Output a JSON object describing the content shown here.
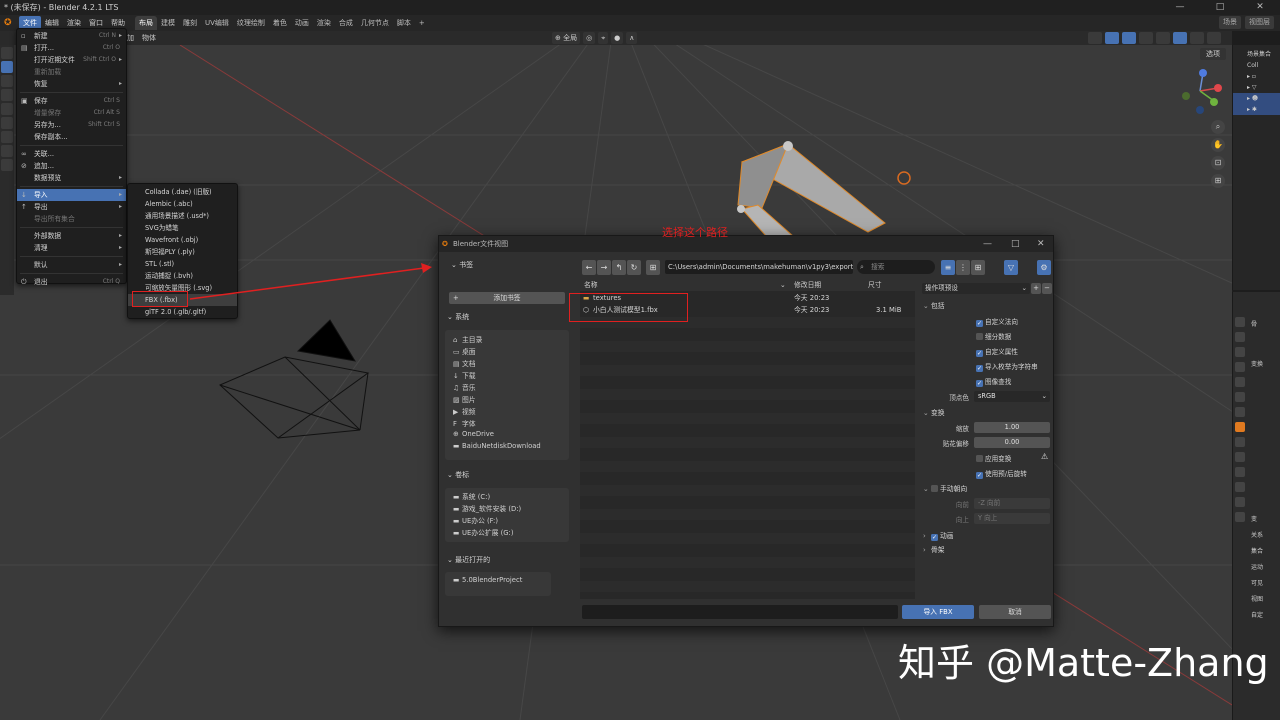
{
  "window": {
    "title": "* (未保存) - Blender 4.2.1 LTS",
    "controls": [
      "—",
      "□",
      "✕"
    ]
  },
  "menubar": {
    "menus": [
      "文件",
      "编辑",
      "渲染",
      "窗口",
      "帮助"
    ],
    "workspaces": [
      "布局",
      "建模",
      "雕刻",
      "UV编辑",
      "纹理绘制",
      "着色",
      "动画",
      "渲染",
      "合成",
      "几何节点",
      "脚本",
      "+"
    ],
    "right_items": [
      "场景",
      "视图层"
    ]
  },
  "viewport_header": {
    "items": [
      "添加",
      "物体"
    ],
    "pivot": "全局",
    "select_label": "选项"
  },
  "file_menu": {
    "items": [
      {
        "label": "新建",
        "shortcut": "Ctrl N",
        "arrow": true,
        "icon": "▫"
      },
      {
        "label": "打开...",
        "shortcut": "Ctrl O",
        "icon": "▤"
      },
      {
        "label": "打开近期文件",
        "shortcut": "Shift Ctrl O",
        "arrow": true
      },
      {
        "label": "重新加载",
        "disabled": true
      },
      {
        "label": "恢复",
        "arrow": true
      },
      {
        "sep": true
      },
      {
        "label": "保存",
        "shortcut": "Ctrl S",
        "icon": "▣"
      },
      {
        "label": "增量保存",
        "shortcut": "Ctrl Alt S",
        "disabled": true
      },
      {
        "label": "另存为...",
        "shortcut": "Shift Ctrl S"
      },
      {
        "label": "保存副本..."
      },
      {
        "sep": true
      },
      {
        "label": "关联...",
        "icon": "∞"
      },
      {
        "label": "追加...",
        "icon": "⊘"
      },
      {
        "label": "数据预览",
        "arrow": true
      },
      {
        "sep": true
      },
      {
        "label": "导入",
        "arrow": true,
        "highlighted": true,
        "icon": "↓"
      },
      {
        "label": "导出",
        "arrow": true,
        "icon": "↑"
      },
      {
        "label": "导出所有集合",
        "disabled": true
      },
      {
        "sep": true
      },
      {
        "label": "外部数据",
        "arrow": true
      },
      {
        "label": "清理",
        "arrow": true
      },
      {
        "sep": true
      },
      {
        "label": "默认",
        "arrow": true
      },
      {
        "sep": true
      },
      {
        "label": "退出",
        "shortcut": "Ctrl Q",
        "icon": "⏻"
      }
    ]
  },
  "import_submenu": {
    "items": [
      "Collada (.dae) (旧版)",
      "Alembic (.abc)",
      "通用场景描述 (.usd*)",
      "SVG为蜡笔",
      "Wavefront (.obj)",
      "斯坦福PLY (.ply)",
      "STL (.stl)",
      "运动捕捉 (.bvh)",
      "可缩放矢量图形 (.svg)",
      "FBX (.fbx)",
      "glTF 2.0 (.glb/.gltf)"
    ],
    "highlighted_index": 9
  },
  "annotation": {
    "callout": "选择这个路径",
    "color": "#e02020"
  },
  "dialog": {
    "title": "Blender文件视图",
    "bookmarks": {
      "header": "书签",
      "add_label": "添加书签"
    },
    "system": {
      "header": "系统",
      "items": [
        {
          "label": "主目录",
          "icon": "⌂"
        },
        {
          "label": "桌面",
          "icon": "▭"
        },
        {
          "label": "文档",
          "icon": "▤"
        },
        {
          "label": "下载",
          "icon": "↓"
        },
        {
          "label": "音乐",
          "icon": "♫"
        },
        {
          "label": "图片",
          "icon": "▨"
        },
        {
          "label": "视频",
          "icon": "▶"
        },
        {
          "label": "字体",
          "icon": "F"
        },
        {
          "label": "OneDrive",
          "icon": "⊕"
        },
        {
          "label": "BaiduNetdiskDownload",
          "icon": "▬"
        }
      ]
    },
    "volumes": {
      "header": "卷标",
      "items": [
        "系统 (C:)",
        "游戏_软件安装 (D:)",
        "UE办公 (F:)",
        "UE办公扩展 (G:)"
      ]
    },
    "recent": {
      "header": "最近打开的",
      "items": [
        "5.0BlenderProject"
      ]
    },
    "path": "C:\\Users\\admin\\Documents\\makehuman\\v1py3\\exports\\",
    "search_placeholder": "搜索",
    "columns": {
      "name": "名称",
      "date": "修改日期",
      "size": "尺寸"
    },
    "files": [
      {
        "name": "textures",
        "date": "今天 20:23",
        "size": "",
        "type": "folder"
      },
      {
        "name": "小白人测试模型1.fbx",
        "date": "今天 20:23",
        "size": "3.1 MiB",
        "type": "file"
      }
    ],
    "import_button": "导入 FBX",
    "cancel_button": "取消",
    "options": {
      "preset_label": "操作项预设",
      "include": {
        "header": "包括",
        "checks": [
          {
            "label": "自定义法向",
            "on": true
          },
          {
            "label": "细分数据",
            "on": false
          },
          {
            "label": "自定义属性",
            "on": true
          },
          {
            "label": "导入枚举为字符串",
            "on": true
          },
          {
            "label": "图像查找",
            "on": true
          }
        ],
        "vertex_color_label": "顶点色",
        "vertex_color_value": "sRGB"
      },
      "transform": {
        "header": "变换",
        "scale_label": "缩放",
        "scale_value": "1.00",
        "decal_label": "贴花偏移",
        "decal_value": "0.00",
        "apply_transform": "应用变换",
        "use_pre_post_rot": "使用预/后旋转"
      },
      "manual_orientation": {
        "header": "手动朝向",
        "forward_label": "向前",
        "forward_value": "-Z 向前",
        "up_label": "向上",
        "up_value": "Y 向上"
      },
      "animation": "动画",
      "armature": "骨架"
    }
  },
  "right_panels": {
    "outliner_rows": [
      "场景集合",
      "Coll",
      "",
      "",
      "",
      ""
    ],
    "props_rows": [
      "骨",
      "变换",
      "变",
      "关系",
      "集合",
      "运动",
      "可见",
      "视图",
      "自定"
    ]
  },
  "watermark": "知乎 @Matte-Zhang"
}
